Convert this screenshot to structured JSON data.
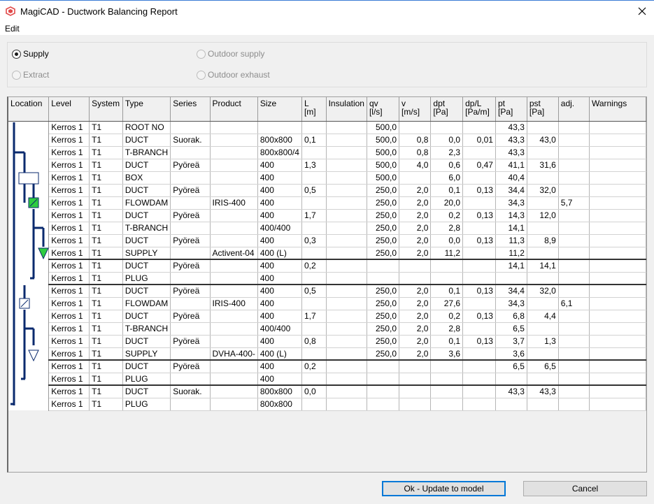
{
  "window": {
    "title": "MagiCAD - Ductwork Balancing Report"
  },
  "menu": {
    "edit": "Edit"
  },
  "options": {
    "supply": "Supply",
    "extract": "Extract",
    "outdoor_supply": "Outdoor supply",
    "outdoor_exhaust": "Outdoor exhaust"
  },
  "columns": [
    "Location",
    "Level",
    "System",
    "Type",
    "Series",
    "Product",
    "Size",
    "L\n[m]",
    "Insulation",
    "qv\n[l/s]",
    "v\n[m/s]",
    "dpt\n[Pa]",
    "dp/L\n[Pa/m]",
    "pt\n[Pa]",
    "pst\n[Pa]",
    "adj.",
    "Warnings"
  ],
  "rows": [
    [
      "Kerros 1",
      "T1",
      "ROOT NO",
      "",
      "",
      "",
      "",
      "",
      "500,0",
      "",
      "",
      "",
      "43,3",
      "",
      "",
      ""
    ],
    [
      "Kerros 1",
      "T1",
      "DUCT",
      "Suorak.",
      "",
      "800x800",
      "0,1",
      "",
      "500,0",
      "0,8",
      "0,0",
      "0,01",
      "43,3",
      "43,0",
      "",
      ""
    ],
    [
      "Kerros 1",
      "T1",
      "T-BRANCH",
      "",
      "",
      "800x800/4",
      "",
      "",
      "500,0",
      "0,8",
      "2,3",
      "",
      "43,3",
      "",
      "",
      ""
    ],
    [
      "Kerros 1",
      "T1",
      "DUCT",
      "Pyöreä",
      "",
      "400",
      "1,3",
      "",
      "500,0",
      "4,0",
      "0,6",
      "0,47",
      "41,1",
      "31,6",
      "",
      ""
    ],
    [
      "Kerros 1",
      "T1",
      "BOX",
      "",
      "",
      "400",
      "",
      "",
      "500,0",
      "",
      "6,0",
      "",
      "40,4",
      "",
      "",
      ""
    ],
    [
      "Kerros 1",
      "T1",
      "DUCT",
      "Pyöreä",
      "",
      "400",
      "0,5",
      "",
      "250,0",
      "2,0",
      "0,1",
      "0,13",
      "34,4",
      "32,0",
      "",
      ""
    ],
    [
      "Kerros 1",
      "T1",
      "FLOWDAM",
      "",
      "IRIS-400",
      "400",
      "",
      "",
      "250,0",
      "2,0",
      "20,0",
      "",
      "34,3",
      "",
      "5,7",
      ""
    ],
    [
      "Kerros 1",
      "T1",
      "DUCT",
      "Pyöreä",
      "",
      "400",
      "1,7",
      "",
      "250,0",
      "2,0",
      "0,2",
      "0,13",
      "14,3",
      "12,0",
      "",
      ""
    ],
    [
      "Kerros 1",
      "T1",
      "T-BRANCH",
      "",
      "",
      "400/400",
      "",
      "",
      "250,0",
      "2,0",
      "2,8",
      "",
      "14,1",
      "",
      "",
      ""
    ],
    [
      "Kerros 1",
      "T1",
      "DUCT",
      "Pyöreä",
      "",
      "400",
      "0,3",
      "",
      "250,0",
      "2,0",
      "0,0",
      "0,13",
      "11,3",
      "8,9",
      "",
      ""
    ],
    [
      "Kerros 1",
      "T1",
      "SUPPLY",
      "",
      "Activent-04",
      "400 (L)",
      "",
      "",
      "250,0",
      "2,0",
      "11,2",
      "",
      "11,2",
      "",
      "",
      ""
    ],
    [
      "Kerros 1",
      "T1",
      "DUCT",
      "Pyöreä",
      "",
      "400",
      "0,2",
      "",
      "",
      "",
      "",
      "",
      "14,1",
      "14,1",
      "",
      ""
    ],
    [
      "Kerros 1",
      "T1",
      "PLUG",
      "",
      "",
      "400",
      "",
      "",
      "",
      "",
      "",
      "",
      "",
      "",
      "",
      ""
    ],
    [
      "Kerros 1",
      "T1",
      "DUCT",
      "Pyöreä",
      "",
      "400",
      "0,5",
      "",
      "250,0",
      "2,0",
      "0,1",
      "0,13",
      "34,4",
      "32,0",
      "",
      ""
    ],
    [
      "Kerros 1",
      "T1",
      "FLOWDAM",
      "",
      "IRIS-400",
      "400",
      "",
      "",
      "250,0",
      "2,0",
      "27,6",
      "",
      "34,3",
      "",
      "6,1",
      ""
    ],
    [
      "Kerros 1",
      "T1",
      "DUCT",
      "Pyöreä",
      "",
      "400",
      "1,7",
      "",
      "250,0",
      "2,0",
      "0,2",
      "0,13",
      "6,8",
      "4,4",
      "",
      ""
    ],
    [
      "Kerros 1",
      "T1",
      "T-BRANCH",
      "",
      "",
      "400/400",
      "",
      "",
      "250,0",
      "2,0",
      "2,8",
      "",
      "6,5",
      "",
      "",
      ""
    ],
    [
      "Kerros 1",
      "T1",
      "DUCT",
      "Pyöreä",
      "",
      "400",
      "0,8",
      "",
      "250,0",
      "2,0",
      "0,1",
      "0,13",
      "3,7",
      "1,3",
      "",
      ""
    ],
    [
      "Kerros 1",
      "T1",
      "SUPPLY",
      "",
      "DVHA-400-",
      "400 (L)",
      "",
      "",
      "250,0",
      "2,0",
      "3,6",
      "",
      "3,6",
      "",
      "",
      ""
    ],
    [
      "Kerros 1",
      "T1",
      "DUCT",
      "Pyöreä",
      "",
      "400",
      "0,2",
      "",
      "",
      "",
      "",
      "",
      "6,5",
      "6,5",
      "",
      ""
    ],
    [
      "Kerros 1",
      "T1",
      "PLUG",
      "",
      "",
      "400",
      "",
      "",
      "",
      "",
      "",
      "",
      "",
      "",
      "",
      ""
    ],
    [
      "Kerros 1",
      "T1",
      "DUCT",
      "Suorak.",
      "",
      "800x800",
      "0,0",
      "",
      "",
      "",
      "",
      "",
      "43,3",
      "43,3",
      "",
      ""
    ],
    [
      "Kerros 1",
      "T1",
      "PLUG",
      "",
      "",
      "800x800",
      "",
      "",
      "",
      "",
      "",
      "",
      "",
      "",
      "",
      ""
    ]
  ],
  "branch_end_rows": [
    10,
    12,
    18,
    20
  ],
  "buttons": {
    "ok": "Ok - Update to model",
    "cancel": "Cancel"
  },
  "colors": {
    "duct": "#0a2a6e",
    "flowdamper": "#2ecc40",
    "supply_terminal": "#2ecc40"
  },
  "icons": {
    "app": "magicad-logo-icon",
    "close": "close-icon"
  }
}
